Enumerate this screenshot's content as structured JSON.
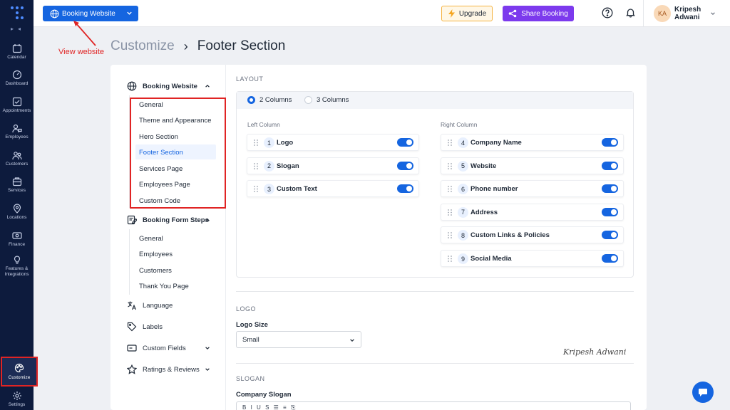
{
  "sidebar": {
    "items": [
      {
        "label": "Calendar",
        "icon": "calendar-icon"
      },
      {
        "label": "Dashboard",
        "icon": "dashboard-icon"
      },
      {
        "label": "Appointments",
        "icon": "appointments-icon"
      },
      {
        "label": "Employees",
        "icon": "employees-icon"
      },
      {
        "label": "Customers",
        "icon": "customers-icon"
      },
      {
        "label": "Services",
        "icon": "services-icon"
      },
      {
        "label": "Locations",
        "icon": "location-pin-icon"
      },
      {
        "label": "Finance",
        "icon": "finance-icon"
      },
      {
        "label": "Features &",
        "label2": "Integrations",
        "icon": "lightbulb-icon"
      },
      {
        "label": "Customize",
        "icon": "palette-icon",
        "active": true
      },
      {
        "label": "Settings",
        "icon": "gear-icon"
      }
    ]
  },
  "topbar": {
    "site_selector": "Booking Website",
    "upgrade": "Upgrade",
    "share": "Share Booking",
    "user": {
      "initials": "KA",
      "first": "Kripesh",
      "last": "Adwani"
    }
  },
  "annotation": {
    "view_website": "View website"
  },
  "breadcrumb": {
    "parent": "Customize",
    "separator": "›",
    "current": "Footer Section"
  },
  "settings_nav": {
    "booking_website": {
      "label": "Booking Website",
      "items": [
        "General",
        "Theme and Appearance",
        "Hero Section",
        "Footer Section",
        "Services Page",
        "Employees Page",
        "Custom Code"
      ],
      "active": "Footer Section"
    },
    "booking_form_steps": {
      "label": "Booking Form Steps",
      "items": [
        "General",
        "Employees",
        "Customers",
        "Thank You Page"
      ]
    },
    "language": "Language",
    "labels": "Labels",
    "custom_fields": "Custom Fields",
    "ratings_reviews": "Ratings & Reviews"
  },
  "layout": {
    "section_title": "LAYOUT",
    "columns_options": [
      "2 Columns",
      "3 Columns"
    ],
    "columns_selected": "2 Columns",
    "left_column": {
      "title": "Left Column",
      "rows": [
        {
          "num": "1",
          "label": "Logo",
          "enabled": true
        },
        {
          "num": "2",
          "label": "Slogan",
          "enabled": true
        },
        {
          "num": "3",
          "label": "Custom Text",
          "enabled": true
        }
      ]
    },
    "right_column": {
      "title": "Right Column",
      "rows": [
        {
          "num": "4",
          "label": "Company Name",
          "enabled": true
        },
        {
          "num": "5",
          "label": "Website",
          "enabled": true
        },
        {
          "num": "6",
          "label": "Phone number",
          "enabled": true
        },
        {
          "num": "7",
          "label": "Address",
          "enabled": true
        },
        {
          "num": "8",
          "label": "Custom Links & Policies",
          "enabled": true
        },
        {
          "num": "9",
          "label": "Social Media",
          "enabled": true
        }
      ]
    }
  },
  "logo": {
    "section_title": "LOGO",
    "size_label": "Logo Size",
    "size_value": "Small"
  },
  "slogan": {
    "section_title": "SLOGAN",
    "company_slogan_label": "Company Slogan"
  },
  "signature": "Kripesh Adwani",
  "colors": {
    "primary": "#1565e0",
    "sidebar_bg": "#0d1b3d",
    "share": "#7c3aed",
    "highlight": "#e02424"
  }
}
